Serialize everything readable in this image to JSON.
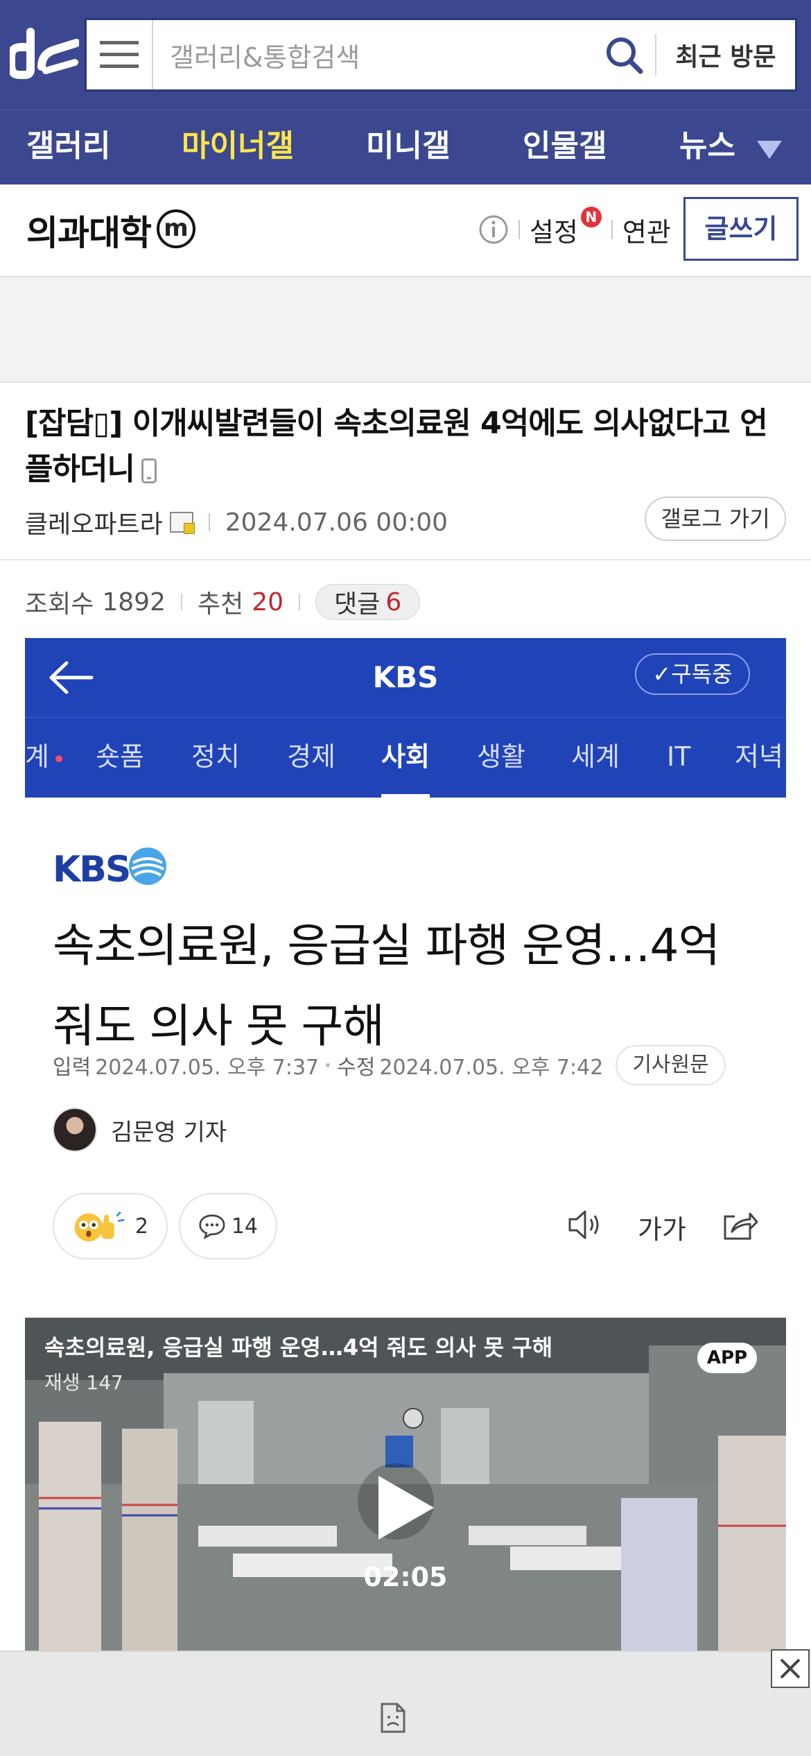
{
  "header": {
    "search_placeholder": "갤러리&통합검색",
    "recent_label": "최근 방문"
  },
  "nav": {
    "items": [
      "갤러리",
      "마이너갤",
      "미니갤",
      "인물갤",
      "뉴스"
    ],
    "active": "마이너갤"
  },
  "gallery": {
    "name": "의과대학",
    "badge": "m",
    "settings_label": "설정",
    "new_badge": "N",
    "related_label": "연관",
    "write_label": "글쓰기"
  },
  "post": {
    "title": "[잡담▯] 이개씨발련들이 속초의료원 4억에도 의사없다고 언플하더니",
    "author": "클레오파트라",
    "date": "2024.07.06 00:00",
    "gallog_label": "갤로그 가기",
    "views_label": "조회수",
    "views": "1892",
    "recommend_label": "추천",
    "recommend": "20",
    "comments_label": "댓글",
    "comments": "6"
  },
  "news": {
    "app_title": "KBS",
    "subscribe_label": "✓구독중",
    "tabs": [
      "계",
      "숏폼",
      "정치",
      "경제",
      "사회",
      "생활",
      "세계",
      "IT",
      "저녁"
    ],
    "active_tab": "사회",
    "logo_text": "KBS",
    "headline": "속초의료원, 응급실 파행 운영…4억 줘도 의사 못 구해",
    "input_label": "입력",
    "input_date": "2024.07.05. 오후 7:37",
    "edit_label": "수정",
    "edit_date": "2024.07.05. 오후 7:42",
    "original_label": "기사원문",
    "reporter": "김문영 기자",
    "reaction_count": "2",
    "comment_count": "14",
    "font_size_label": "가가",
    "video": {
      "title": "속초의료원, 응급실 파행 운영…4억 줘도 의사 못 구해",
      "plays": "재생 147",
      "app_badge": "APP",
      "duration": "02:05"
    }
  }
}
